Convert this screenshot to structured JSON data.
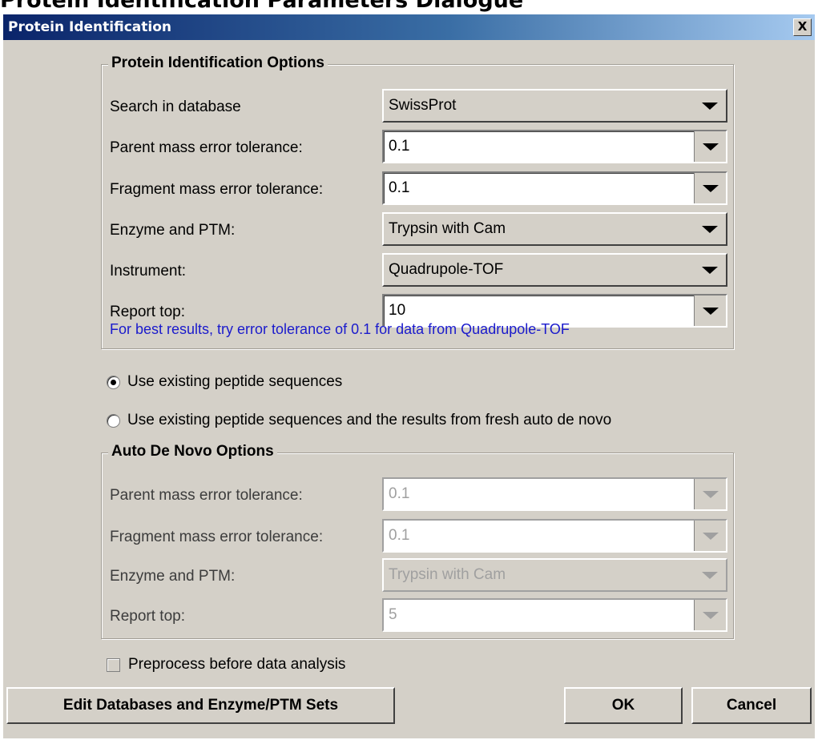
{
  "page_heading": "Protein Identification Parameters Dialogue",
  "dialog": {
    "title": "Protein Identification",
    "close_label": "X"
  },
  "protein_options": {
    "title": "Protein Identification Options",
    "rows": [
      {
        "label": "Search in database",
        "value": "SwissProt"
      },
      {
        "label": "Parent mass error tolerance:",
        "value": "0.1"
      },
      {
        "label": "Fragment mass error tolerance:",
        "value": "0.1"
      },
      {
        "label": "Enzyme and PTM:",
        "value": "Trypsin with Cam"
      },
      {
        "label": "Instrument:",
        "value": "Quadrupole-TOF"
      },
      {
        "label": "Report top:",
        "value": "10"
      }
    ],
    "hint": "For best results, try error tolerance of 0.1 for data from Quadrupole-TOF",
    "hint_color": "#1a1acc"
  },
  "sequence_source": {
    "option_existing": "Use existing peptide sequences",
    "option_existing_and_denovo": "Use existing peptide sequences and the results from fresh auto de novo",
    "selected": "option_existing"
  },
  "denovo_options": {
    "title": "Auto De Novo Options",
    "rows": [
      {
        "label": "Parent mass error tolerance:",
        "value": "0.1"
      },
      {
        "label": "Fragment mass error tolerance:",
        "value": "0.1"
      },
      {
        "label": "Enzyme and PTM:",
        "value": "Trypsin with Cam"
      },
      {
        "label": "Report top:",
        "value": "5"
      }
    ]
  },
  "preprocess": {
    "label": "Preprocess before data analysis",
    "checked": false
  },
  "buttons": {
    "edit_databases": "Edit Databases and Enzyme/PTM Sets",
    "ok": "OK",
    "cancel": "Cancel"
  },
  "colors": {
    "titlebar_start": "#0a246a",
    "titlebar_end": "#a6caf0",
    "dialog_bg": "#d4d0c8"
  },
  "icons": {
    "dropdown": "chevron-down-icon",
    "close": "close-icon"
  }
}
